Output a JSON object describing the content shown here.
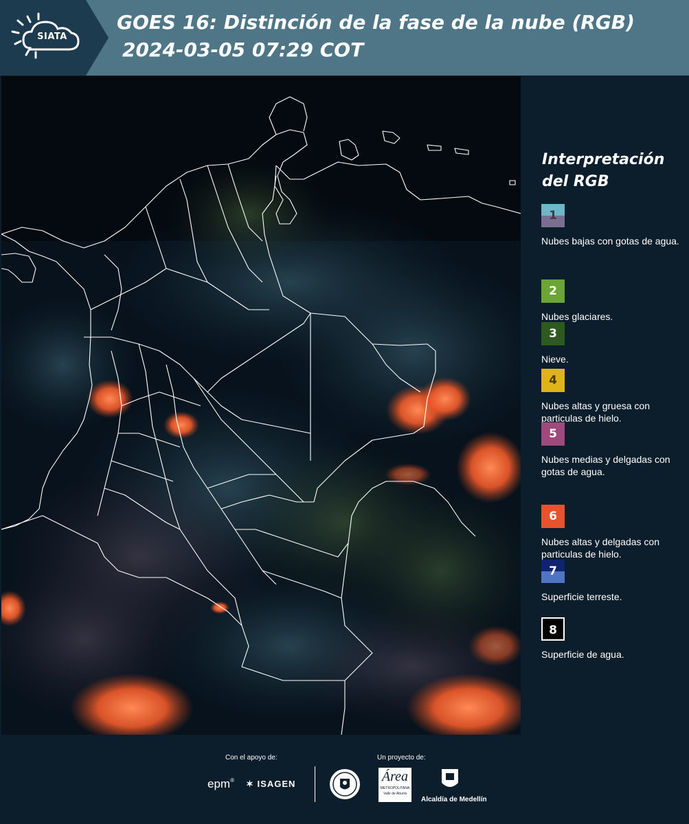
{
  "header": {
    "logo_text": "SIATA",
    "title_line1": "GOES 16: Distinción de la fase de la nube (RGB)",
    "title_line2": "2024-03-05 07:29 COT"
  },
  "legend": {
    "title": "Interpretación del RGB",
    "items": [
      {
        "number": "1",
        "label": "Nubes bajas con gotas de agua.",
        "color_top": "#6fb7c7",
        "color_bottom": "#7a6f8e",
        "text_color": "#3c3c4c"
      },
      {
        "number": "2",
        "label": "Nubes glaciares.",
        "color_top": "#6aa535",
        "color_bottom": "#6aa535",
        "text_color": "#ffffff"
      },
      {
        "number": "3",
        "label": "Nieve.",
        "color_top": "#2d5a1e",
        "color_bottom": "#2d5a1e",
        "text_color": "#ffffff"
      },
      {
        "number": "4",
        "label": "Nubes altas y gruesa con particulas de hielo.",
        "color_top": "#e0b318",
        "color_bottom": "#e0b318",
        "text_color": "#4a3a10"
      },
      {
        "number": "5",
        "label": "Nubes medias y delgadas con gotas de agua.",
        "color_top": "#a0497c",
        "color_bottom": "#a0497c",
        "text_color": "#ffffff"
      },
      {
        "number": "6",
        "label": "Nubes altas y delgadas con particulas de hielo.",
        "color_top": "#e8532d",
        "color_bottom": "#e8532d",
        "text_color": "#ffffff"
      },
      {
        "number": "7",
        "label": "Superficie terreste.",
        "color_top": "#0e2470",
        "color_bottom": "#4f74c4",
        "text_color": "#ffffff"
      },
      {
        "number": "8",
        "label": "Superficie de agua.",
        "color_top": "#000000",
        "color_bottom": "#000000",
        "text_color": "#ffffff"
      }
    ]
  },
  "footer": {
    "support_label": "Con el apoyo de:",
    "project_label": "Un proyecto de:",
    "sponsor_epm": "epm",
    "sponsor_isagen": "ISAGEN",
    "partner_area_name": "Área",
    "partner_area_sub": "METROPOLITANA",
    "partner_area_sub2": "Valle de Aburrá",
    "partner_alcaldia": "Alcaldía de Medellín"
  },
  "colors": {
    "header_bg": "#4f7686",
    "page_bg": "#0c1e2c",
    "cloud_high_thin_ice": "#f05a2a",
    "boundary_lines": "#ffffff"
  }
}
